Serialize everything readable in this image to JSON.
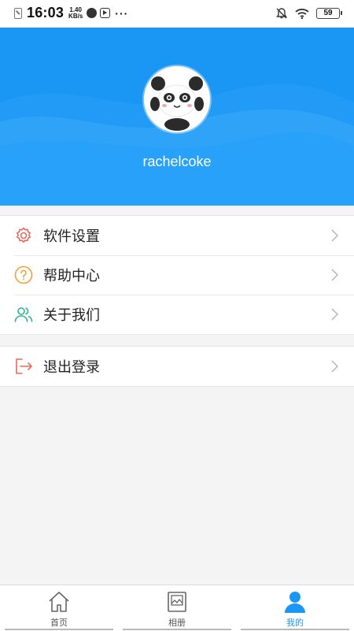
{
  "status_bar": {
    "time": "16:03",
    "speed_value": "1.40",
    "speed_unit": "KB/s",
    "more": "···",
    "battery": "59"
  },
  "profile": {
    "username": "rachelcoke",
    "avatar_icon": "panda-avatar-icon"
  },
  "menu": {
    "items": [
      {
        "label": "软件设置",
        "icon": "gear-icon"
      },
      {
        "label": "帮助中心",
        "icon": "help-icon"
      },
      {
        "label": "关于我们",
        "icon": "users-icon"
      }
    ],
    "logout": {
      "label": "退出登录",
      "icon": "logout-icon"
    }
  },
  "tabbar": {
    "tabs": [
      {
        "label": "首页",
        "icon": "home-icon"
      },
      {
        "label": "相册",
        "icon": "album-icon"
      },
      {
        "label": "我的",
        "icon": "profile-icon"
      }
    ],
    "active_index": 2
  },
  "colors": {
    "primary": "#1a96f5",
    "gear": "#e86a5c",
    "help": "#f0a23a",
    "users": "#2fb58a",
    "logout": "#e86a5c"
  }
}
